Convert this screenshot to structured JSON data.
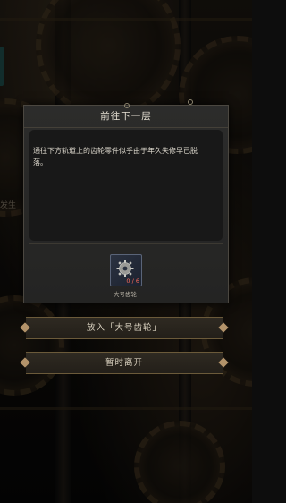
{
  "dialog": {
    "title": "前往下一层",
    "description": "通往下方轨道上的齿轮零件似乎由于年久失修早已脱落。",
    "item": {
      "icon": "gear-icon",
      "name": "大号齿轮",
      "count": "0 / 6"
    }
  },
  "buttons": {
    "put": "放入「大号齿轮」",
    "leave": "暂时离开"
  },
  "background": {
    "side_text": "发生"
  },
  "colors": {
    "dialog_bg": "#2a2a29",
    "button_border": "#6b5a3a",
    "count_red": "#ff6b5a"
  }
}
